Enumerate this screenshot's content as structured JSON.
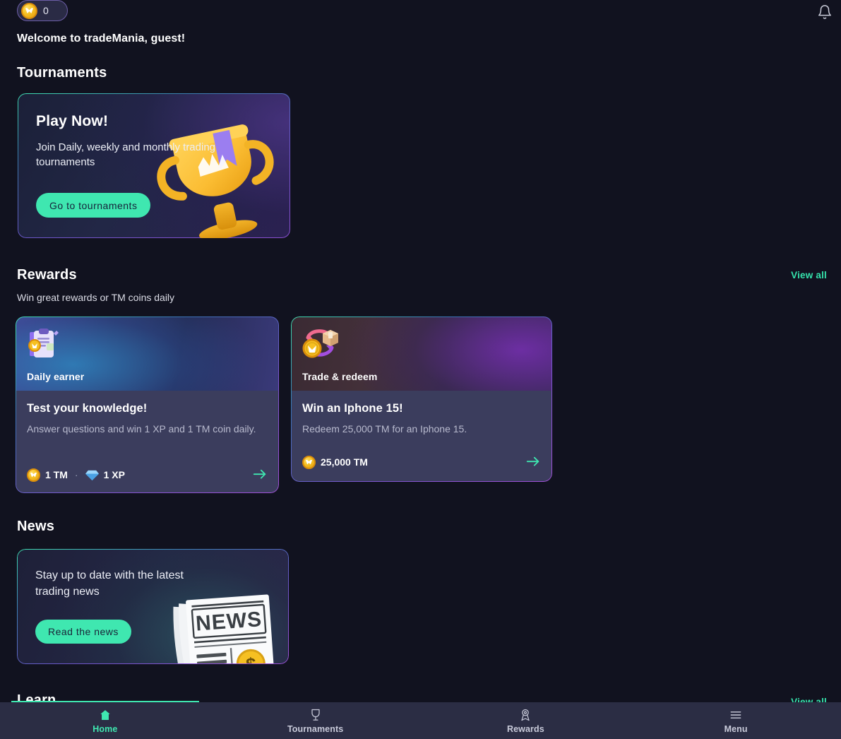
{
  "topbar": {
    "coin_count": "0",
    "coin_icon": "tm-coin-icon",
    "bell_icon": "bell-icon"
  },
  "welcome": "Welcome to tradeMania, guest!",
  "tournaments": {
    "section_title": "Tournaments",
    "card": {
      "title": "Play Now!",
      "description": "Join Daily, weekly and monthly trading tournaments",
      "button_label": "Go to tournaments",
      "illustration": "trophy-illustration"
    }
  },
  "rewards": {
    "section_title": "Rewards",
    "subtitle": "Win great rewards or TM coins daily",
    "view_all_label": "View all",
    "cards": [
      {
        "category": "Daily earner",
        "icon": "clipboard-coin-icon",
        "title": "Test your knowledge!",
        "description": "Answer questions and win 1 XP and 1 TM coin daily.",
        "reward_tm": "1 TM",
        "reward_separator": "·",
        "reward_xp": "1 XP",
        "arrow_icon": "arrow-right-icon"
      },
      {
        "category": "Trade & redeem",
        "icon": "coin-package-swap-icon",
        "title": "Win an Iphone 15!",
        "description": "Redeem 25,000 TM for an Iphone 15.",
        "cost": "25,000 TM",
        "arrow_icon": "arrow-right-icon"
      }
    ]
  },
  "news": {
    "section_title": "News",
    "card": {
      "text": "Stay up to date with the latest trading news",
      "button_label": "Read the news",
      "illustration": "newspaper-illustration"
    }
  },
  "learn": {
    "section_title": "Learn",
    "view_all_label": "View all"
  },
  "bottom_nav": {
    "items": [
      {
        "label": "Home",
        "icon": "home-icon",
        "active": true
      },
      {
        "label": "Tournaments",
        "icon": "trophy-icon",
        "active": false
      },
      {
        "label": "Rewards",
        "icon": "medal-icon",
        "active": false
      },
      {
        "label": "Menu",
        "icon": "hamburger-icon",
        "active": false
      }
    ]
  },
  "colors": {
    "background": "#11121f",
    "accent": "#3fe7b0",
    "card_body": "#3b3d5d",
    "nav_bar": "#2b2d44",
    "coin_gold": "#f6c022",
    "gem_blue": "#63b8f0"
  }
}
